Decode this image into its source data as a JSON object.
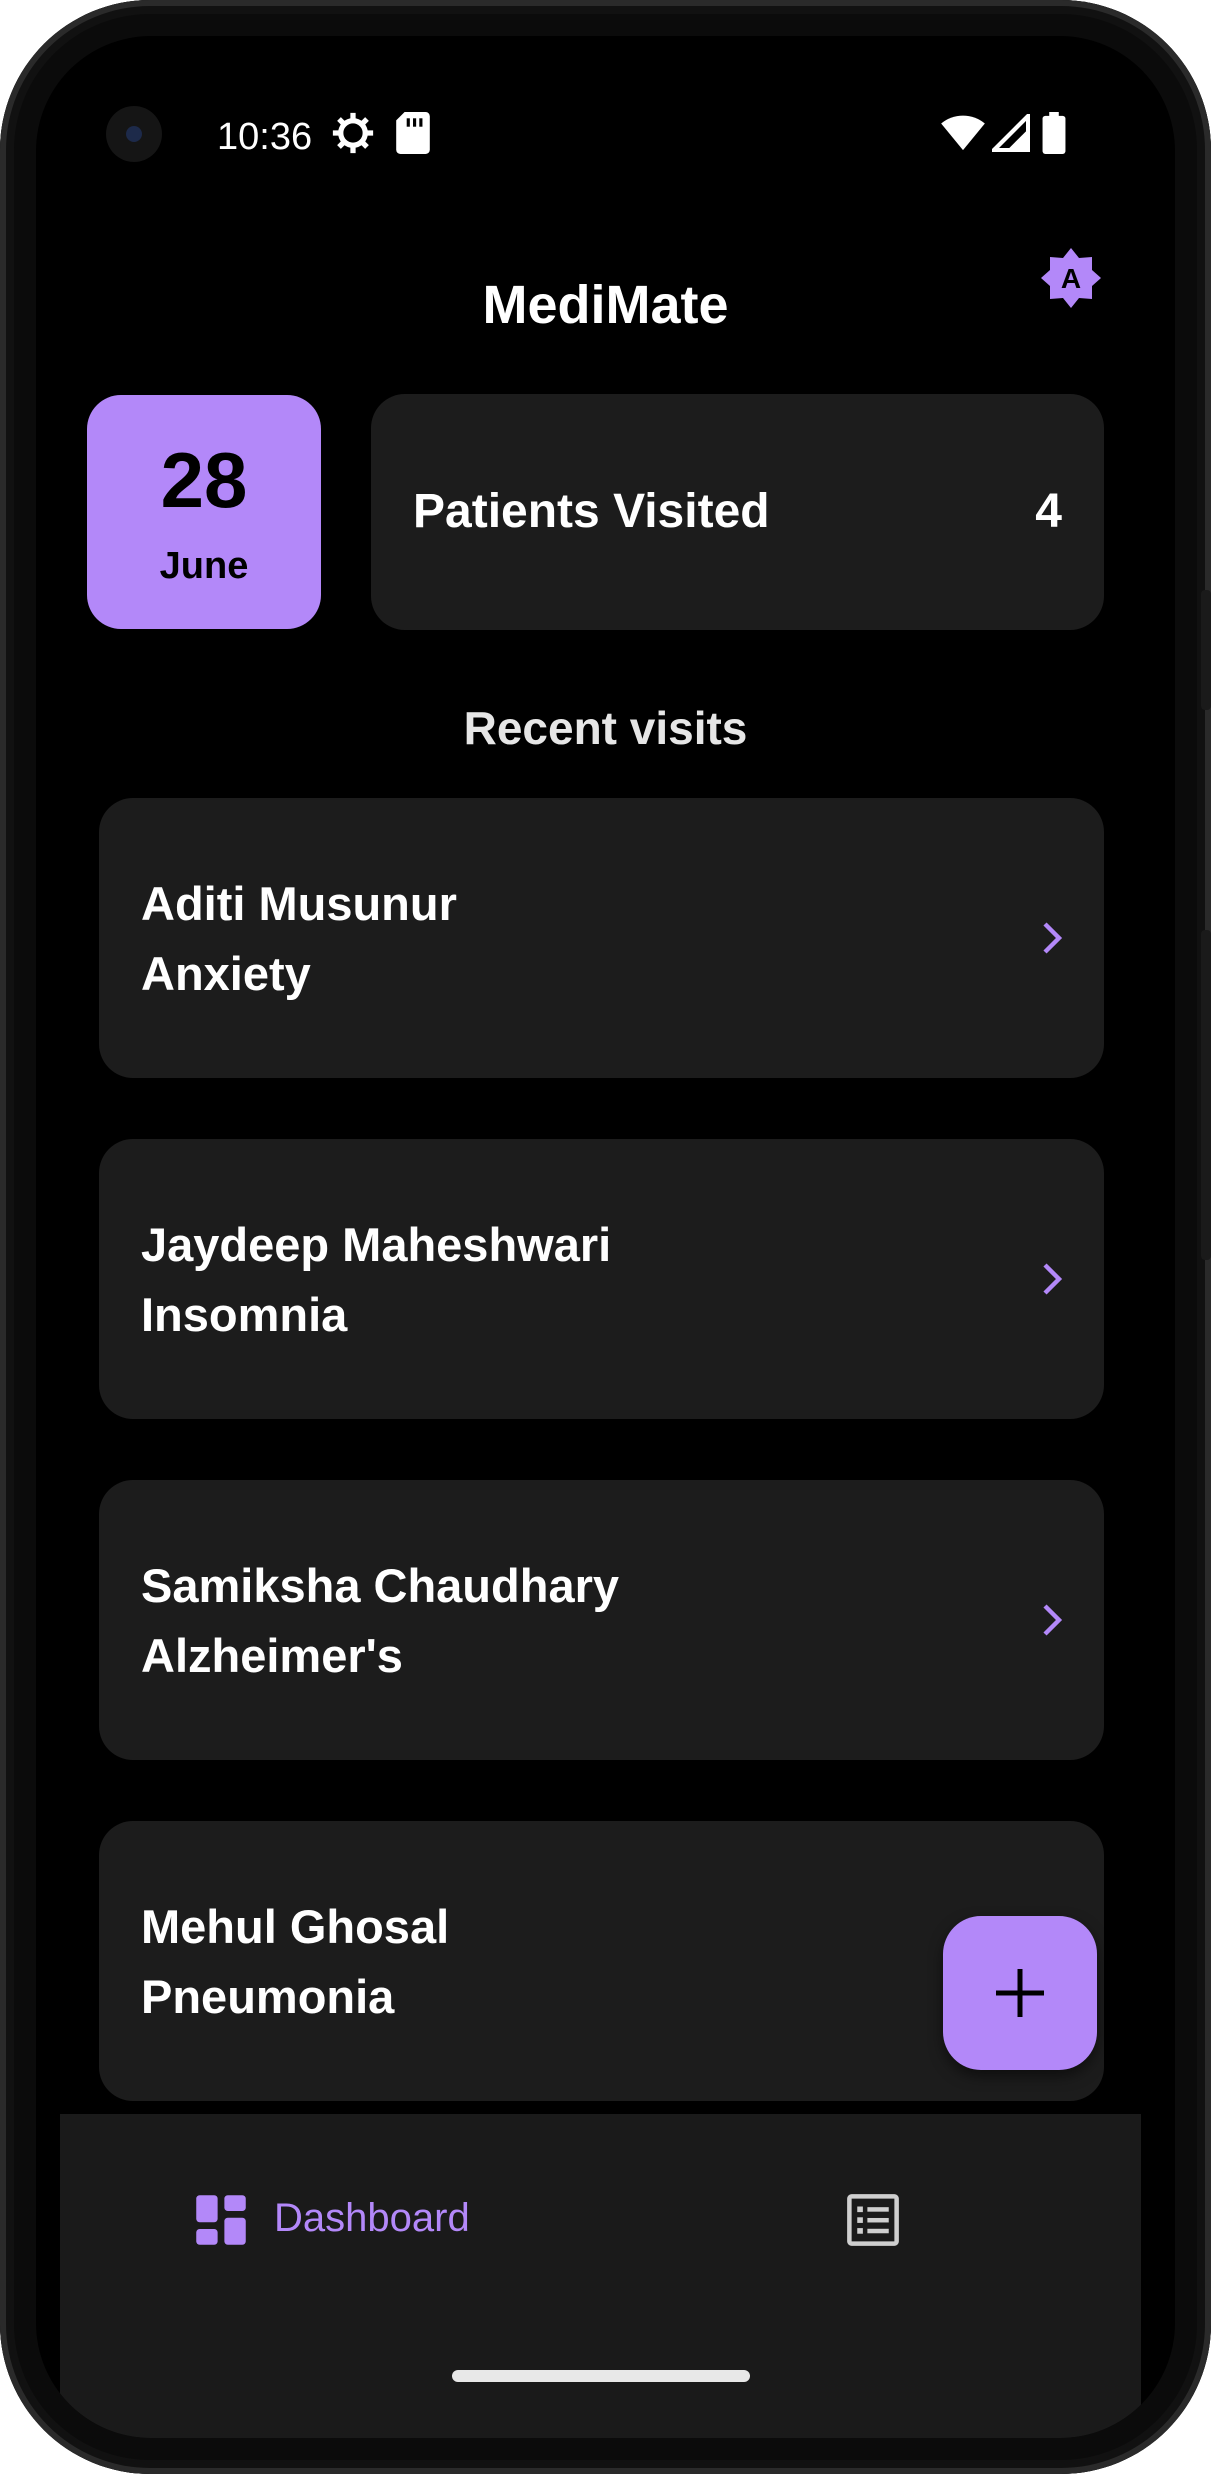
{
  "status_bar": {
    "time": "10:36"
  },
  "app_bar": {
    "title": "MediMate",
    "avatar_letter": "A"
  },
  "summary": {
    "date_day": "28",
    "date_month": "June",
    "patients_label": "Patients Visited",
    "patients_count": "4"
  },
  "recent": {
    "title": "Recent visits",
    "items": [
      {
        "name": "Aditi Musunur",
        "condition": "Anxiety"
      },
      {
        "name": "Jaydeep Maheshwari",
        "condition": "Insomnia"
      },
      {
        "name": "Samiksha Chaudhary",
        "condition": "Alzheimer's"
      },
      {
        "name": "Mehul Ghosal",
        "condition": "Pneumonia"
      }
    ]
  },
  "nav": {
    "dashboard_label": "Dashboard"
  },
  "colors": {
    "accent": "#b388f9",
    "card": "#1c1c1c",
    "background": "#000000"
  },
  "icons": [
    "settings-icon",
    "sd-card-icon",
    "wifi-icon",
    "signal-icon",
    "battery-icon",
    "avatar-badge-icon",
    "chevron-right-icon",
    "plus-icon",
    "dashboard-icon",
    "list-icon"
  ]
}
